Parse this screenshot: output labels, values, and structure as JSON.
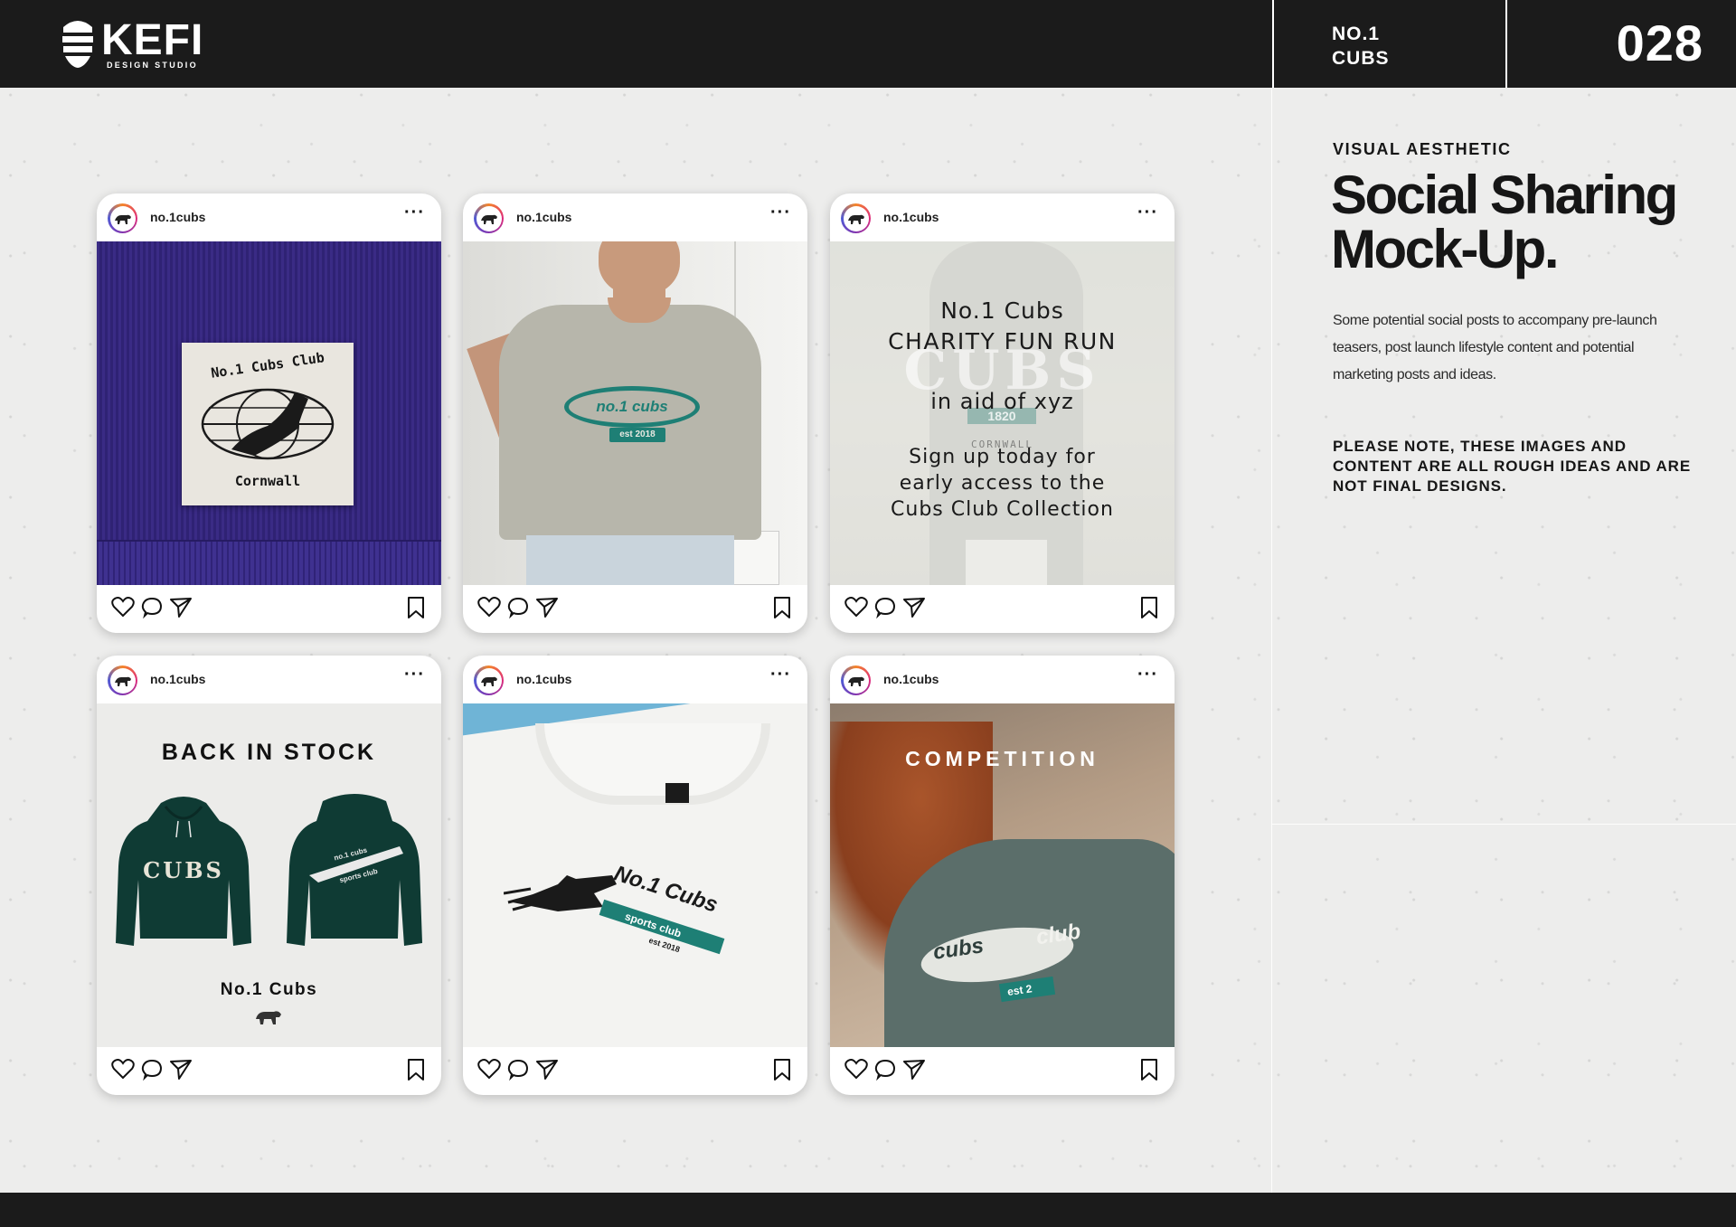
{
  "header": {
    "brand": "KEFI",
    "brand_sub": "DESIGN STUDIO",
    "project_line1": "NO.1",
    "project_line2": "CUBS",
    "page_number": "028"
  },
  "panel": {
    "eyebrow": "VISUAL AESTHETIC",
    "title_line1": "Social Sharing",
    "title_line2": "Mock-Up.",
    "description": "Some potential social posts to accompany pre-launch teasers, post launch lifestyle content and potential marketing posts and ideas.",
    "note": "PLEASE NOTE, THESE IMAGES AND CONTENT ARE ALL ROUGH IDEAS AND ARE NOT FINAL DESIGNS."
  },
  "posts": [
    {
      "username": "no.1cubs",
      "more": "···",
      "label_top": "No.1 Cubs Club",
      "label_bottom": "Cornwall"
    },
    {
      "username": "no.1cubs",
      "more": "···",
      "tee_logo": "no.1 cubs",
      "tee_est": "est 2018"
    },
    {
      "username": "no.1cubs",
      "more": "···",
      "line1": "No.1 Cubs",
      "line2": "CHARITY FUN RUN",
      "line3": "in aid of xyz",
      "line4": "Sign up today for",
      "line5": "early access to the",
      "line6": "Cubs Club Collection",
      "bg_word": "CUBS",
      "bg_year": "1820",
      "bg_place": "CORNWALL"
    },
    {
      "username": "no.1cubs",
      "more": "···",
      "headline": "BACK IN STOCK",
      "hoodie_front": "CUBS",
      "hoodie_back_1": "no.1 cubs",
      "hoodie_back_2": "sports club",
      "footer_text": "No.1 Cubs"
    },
    {
      "username": "no.1cubs",
      "more": "···",
      "print_main": "No.1 Cubs",
      "print_sub": "sports club",
      "print_est": "est 2018"
    },
    {
      "username": "no.1cubs",
      "more": "···",
      "headline": "COMPETITION",
      "sweat_word1": "cubs",
      "sweat_word2": "club",
      "sweat_est": "est 2"
    }
  ],
  "colors": {
    "accent_teal": "#1e7f75",
    "navy_knit": "#35267c",
    "hoodie_green": "#0f3b34",
    "dark": "#1b1b1b"
  },
  "icons": [
    "heart-icon",
    "comment-icon",
    "share-icon",
    "bookmark-icon",
    "more-icon",
    "bear-icon"
  ]
}
